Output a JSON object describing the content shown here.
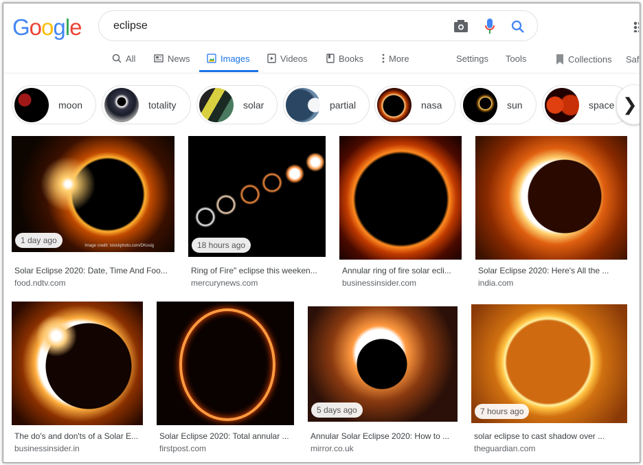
{
  "header": {
    "logo": "Google",
    "query": "eclipse"
  },
  "tabs": [
    {
      "label": "All",
      "icon": "search-icon"
    },
    {
      "label": "News",
      "icon": "news-icon"
    },
    {
      "label": "Images",
      "icon": "image-icon",
      "active": true
    },
    {
      "label": "Videos",
      "icon": "play-icon"
    },
    {
      "label": "Books",
      "icon": "book-icon"
    },
    {
      "label": "More",
      "icon": "more-vert-icon"
    }
  ],
  "tools": {
    "settings": "Settings",
    "tools": "Tools",
    "collections": "Collections",
    "safesearch": "Saf"
  },
  "chips": [
    {
      "label": "moon"
    },
    {
      "label": "totality"
    },
    {
      "label": "solar"
    },
    {
      "label": "partial"
    },
    {
      "label": "nasa"
    },
    {
      "label": "sun"
    },
    {
      "label": "space"
    }
  ],
  "results": [
    {
      "title": "Solar Eclipse 2020: Date, Time And Foo...",
      "source": "food.ndtv.com",
      "badge": "1 day ago",
      "credit": "Image credit: istockphoto.com/DKosig"
    },
    {
      "title": "Ring of Fire\" eclipse this weeken...",
      "source": "mercurynews.com",
      "badge": "18 hours ago"
    },
    {
      "title": "Annular ring of fire solar ecli...",
      "source": "businessinsider.com"
    },
    {
      "title": "Solar Eclipse 2020: Here's All the ...",
      "source": "india.com"
    },
    {
      "title": "The do's and don'ts of a Solar E...",
      "source": "businessinsider.in"
    },
    {
      "title": "Solar Eclipse 2020: Total annular ...",
      "source": "firstpost.com"
    },
    {
      "title": "Annular Solar Eclipse 2020: How to ...",
      "source": "mirror.co.uk",
      "badge": "5 days ago"
    },
    {
      "title": "solar eclipse to cast shadow over ...",
      "source": "theguardian.com",
      "badge": "7 hours ago"
    }
  ],
  "colors": {
    "accent": "#1a73e8",
    "tab_text": "#5f6368"
  }
}
